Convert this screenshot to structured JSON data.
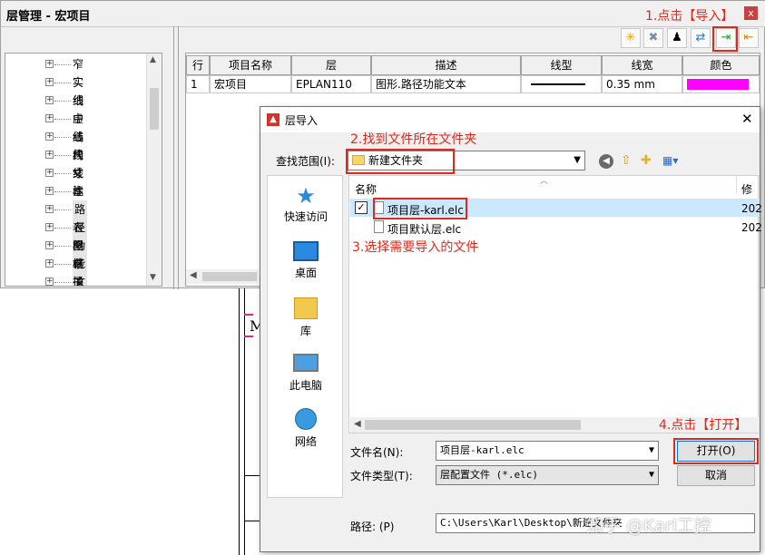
{
  "window": {
    "title": "层管理 - 宏项目",
    "close_glyph": "x"
  },
  "annotations": {
    "step1": "1.点击【导入】",
    "step2": "2.找到文件所在文件夹",
    "step3": "3.选择需要导入的文件",
    "step4": "4.点击【打开】"
  },
  "tree": {
    "items": [
      "窄实线",
      "实线",
      "细虚线",
      "中心线",
      "结构线",
      "尺寸标注",
      "文本",
      "注释文本",
      "路径功能文本",
      "表格",
      "图框",
      "端子排定义",
      "插头定义"
    ]
  },
  "table": {
    "headers": [
      "行",
      "项目名称",
      "层",
      "描述",
      "线型",
      "线宽",
      "颜色"
    ],
    "row": {
      "num": "1",
      "name": "宏项目",
      "layer": "EPLAN110",
      "desc": "图形.路径功能文本",
      "width": "0.35 mm"
    },
    "color_swatch": "#ff00ff"
  },
  "dialog": {
    "title": "层导入",
    "close_glyph": "✕",
    "lookin_label": "查找范围(I):",
    "lookin_value": "新建文件夹",
    "col_name": "名称",
    "col_modified": "修改",
    "files": [
      {
        "name": "项目层-karl.elc",
        "date": "202",
        "checked": true
      },
      {
        "name": "项目默认层.elc",
        "date": "202",
        "checked": false
      }
    ],
    "places": [
      "快速访问",
      "桌面",
      "库",
      "此电脑",
      "网络"
    ],
    "filename_label": "文件名(N):",
    "filename_value": "项目层-karl.elc",
    "filetype_label": "文件类型(T):",
    "filetype_value": "层配置文件 (*.elc)",
    "open_button": "打开(O)",
    "cancel_button": "取消",
    "path_label": "路径: (P)",
    "path_value": "C:\\Users\\Karl\\Desktop\\新建文件夹"
  },
  "watermark": "知乎 @Karl工控",
  "background_text": "M",
  "colors": {
    "accent_red": "#e0281c",
    "selection": "#cce8ff"
  }
}
